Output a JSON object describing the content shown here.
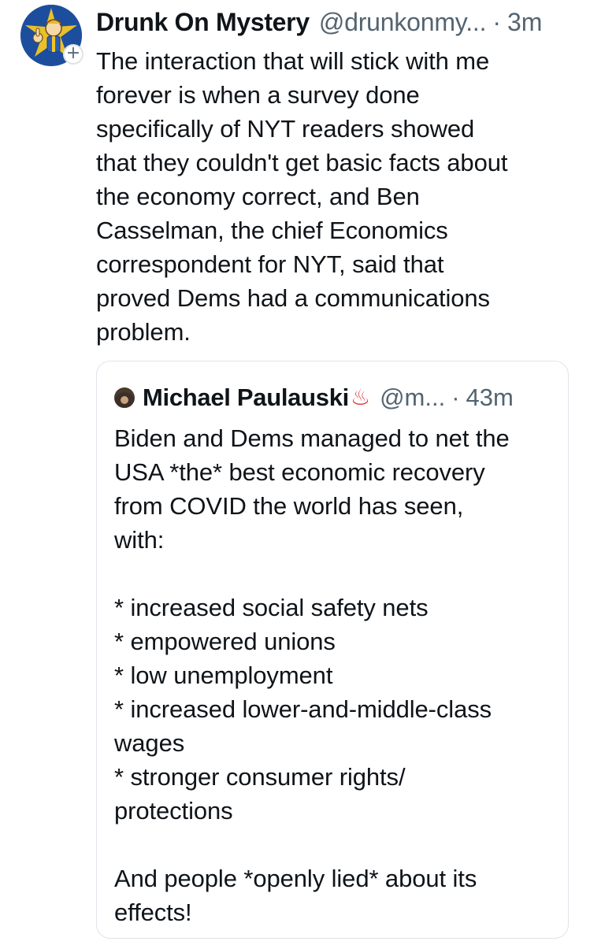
{
  "post": {
    "author": {
      "display_name": "Drunk On Mystery",
      "handle": "@drunkonmy...",
      "avatar_icon": "vault-boy-avatar-icon",
      "follow_badge": "+"
    },
    "separator": "·",
    "time": "3m",
    "text": "The interaction that will stick with me\nforever is when a survey done\nspecifically of NYT readers showed\nthat they couldn't get basic facts about\nthe economy correct, and Ben\nCasselman, the chief Economics\ncorrespondent for NYT, said that\nproved Dems had a communications\nproblem."
  },
  "quote": {
    "author": {
      "display_name": "Michael Paulauski",
      "emoji": "♨",
      "handle": "@m...",
      "avatar_icon": "user-avatar-icon"
    },
    "separator": "·",
    "time": "43m",
    "text": "Biden and Dems managed to net the\nUSA *the* best economic recovery\nfrom COVID the world has seen,\nwith:\n\n* increased social safety nets\n* empowered unions\n* low unemployment\n* increased lower-and-middle-class\nwages\n* stronger consumer rights/\nprotections\n\nAnd people *openly lied* about its\neffects!"
  },
  "colors": {
    "text_primary": "#0f1419",
    "text_secondary": "#536471",
    "border": "#dfe3e8",
    "emoji_red": "#e0313a"
  }
}
